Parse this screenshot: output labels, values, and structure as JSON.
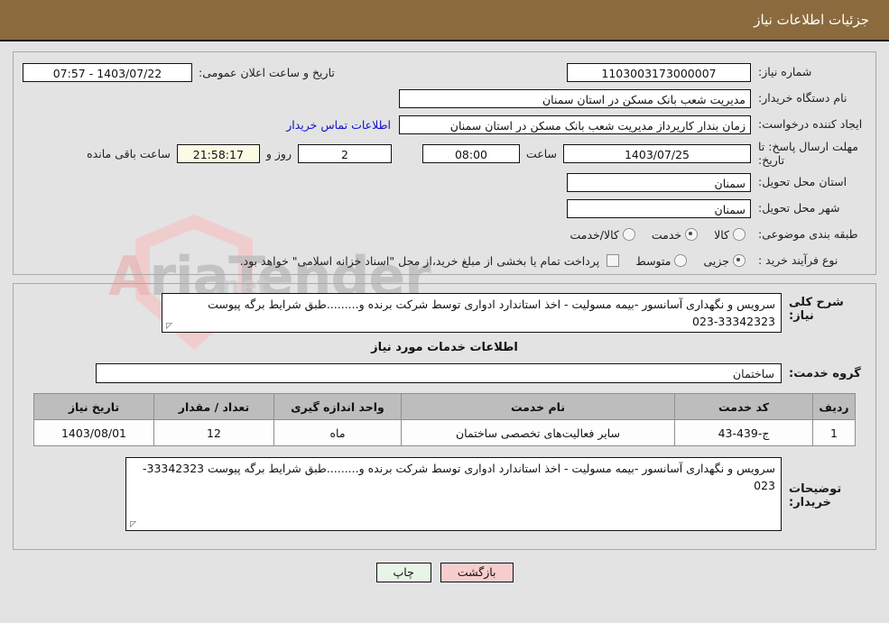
{
  "header": {
    "title": "جزئیات اطلاعات نیاز"
  },
  "form": {
    "need_number": {
      "label": "شماره نیاز:",
      "value": "1103003173000007"
    },
    "buyer_org": {
      "label": "نام دستگاه خریدار:",
      "value": "مدیریت شعب بانک مسکن در استان سمنان"
    },
    "request_creator": {
      "label": "ایجاد کننده درخواست:",
      "value": "زمان بندار کاریرداز مدیریت شعب بانک مسکن در استان سمنان"
    },
    "contact_link": "اطلاعات تماس خریدار",
    "public_announce": {
      "label": "تاریخ و ساعت اعلان عمومی:",
      "value": "1403/07/22 - 07:57"
    },
    "deadline": {
      "label": "مهلت ارسال پاسخ: تا تاریخ:",
      "date": "1403/07/25",
      "time_label": "ساعت",
      "time": "08:00",
      "days": "2",
      "days_label": "روز و",
      "countdown": "21:58:17",
      "countdown_label": "ساعت باقی مانده"
    },
    "delivery_province": {
      "label": "استان محل تحویل:",
      "value": "سمنان"
    },
    "delivery_city": {
      "label": "شهر محل تحویل:",
      "value": "سمنان"
    },
    "category": {
      "label": "طبقه بندی موضوعی:",
      "options": [
        {
          "label": "کالا",
          "selected": false
        },
        {
          "label": "خدمت",
          "selected": true
        },
        {
          "label": "کالا/خدمت",
          "selected": false
        }
      ]
    },
    "purchase_type": {
      "label": "نوع فرآیند خرید :",
      "options": [
        {
          "label": "جزیی",
          "selected": true
        },
        {
          "label": "متوسط",
          "selected": false
        }
      ],
      "checkbox_note": "پرداخت تمام یا بخشی از مبلغ خرید،از محل \"اسناد خزانه اسلامی\" خواهد بود."
    }
  },
  "description": {
    "label": "شرح کلی نیاز:",
    "value": "سرویس و نگهداری آسانسور -بیمه مسولیت - اخذ استاندارد ادواری توسط شرکت برنده و.........طبق شرایط برگه پیوست 33342323-023"
  },
  "services": {
    "section_title": "اطلاعات خدمات مورد نیاز",
    "group_label": "گروه خدمت:",
    "group_value": "ساختمان",
    "columns": [
      "ردیف",
      "کد خدمت",
      "نام خدمت",
      "واحد اندازه گیری",
      "تعداد / مقدار",
      "تاریخ نیاز"
    ],
    "rows": [
      {
        "radif": "1",
        "code": "ج-439-43",
        "name": "سایر فعالیت‌های تخصصی ساختمان",
        "unit": "ماه",
        "qty": "12",
        "date": "1403/08/01"
      }
    ]
  },
  "buyer_notes": {
    "label": "توضیحات خریدار:",
    "value": "سرویس و نگهداری آسانسور -بیمه مسولیت - اخذ استاندارد ادواری توسط شرکت برنده و.........طبق شرایط برگه پیوست 33342323-023"
  },
  "footer": {
    "back_button": "بازگشت",
    "print_button": "چاپ"
  },
  "watermark": {
    "text": "AriaTender",
    "suffix": ".net"
  }
}
